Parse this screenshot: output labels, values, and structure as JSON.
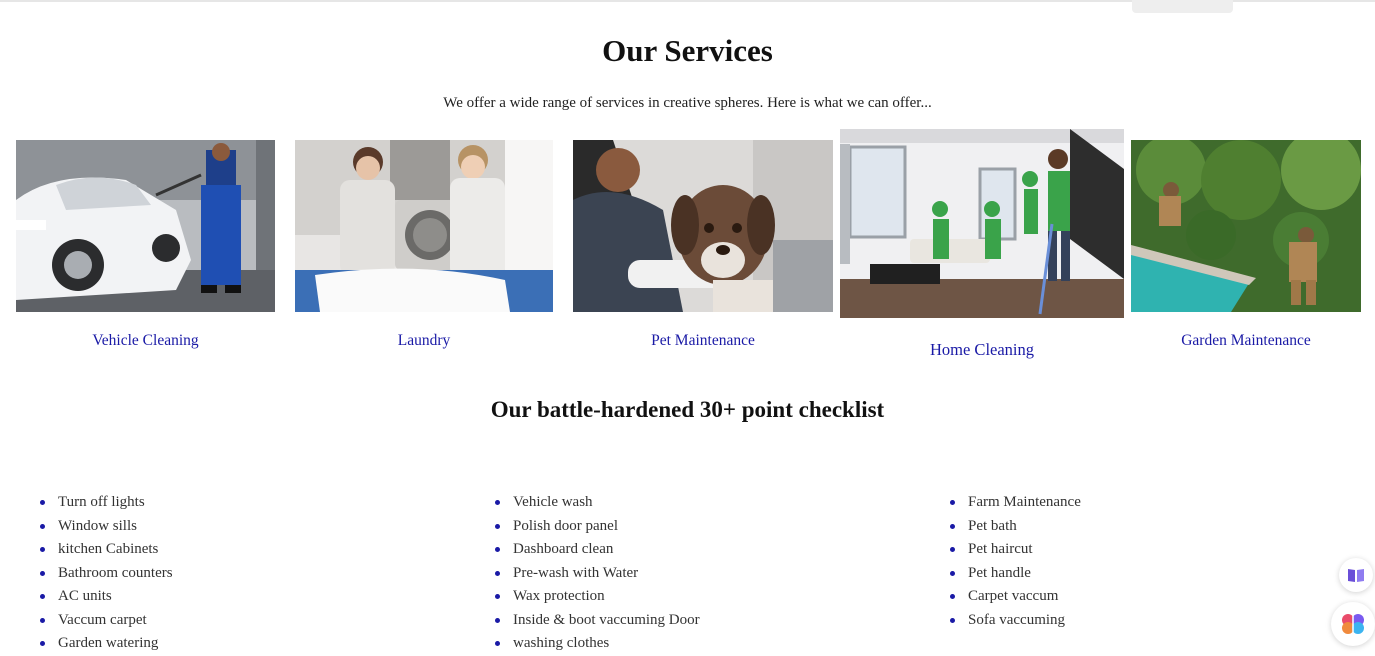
{
  "header": {
    "title": "Our Services",
    "subtitle": "We offer a wide range of services in creative spheres. Here is what we can offer..."
  },
  "services": [
    {
      "label": "Vehicle Cleaning",
      "icon": "vehicle-cleaning-photo"
    },
    {
      "label": "Laundry",
      "icon": "laundry-photo"
    },
    {
      "label": "Pet Maintenance",
      "icon": "pet-maintenance-photo"
    },
    {
      "label": "Home Cleaning",
      "icon": "home-cleaning-photo"
    },
    {
      "label": "Garden Maintenance",
      "icon": "garden-maintenance-photo"
    }
  ],
  "checklist": {
    "title": "Our battle-hardened 30+ point checklist",
    "columns": [
      [
        "Turn off lights",
        "Window sills",
        "kitchen Cabinets",
        "Bathroom counters",
        "AC units",
        "Vaccum carpet",
        "Garden watering"
      ],
      [
        "Vehicle wash",
        "Polish door panel",
        "Dashboard clean",
        "Pre-wash with Water",
        "Wax protection",
        "Inside & boot vaccuming Door",
        "washing clothes"
      ],
      [
        "Farm Maintenance",
        "Pet bath",
        "Pet haircut",
        "Pet handle",
        "Carpet vaccum",
        "Sofa vaccuming"
      ]
    ]
  },
  "floating": {
    "reader_icon": "book-icon",
    "ai_icon": "brain-icon"
  },
  "colors": {
    "link": "#1a1aa6",
    "bullet": "#1a1aa6",
    "heading": "#111111"
  }
}
